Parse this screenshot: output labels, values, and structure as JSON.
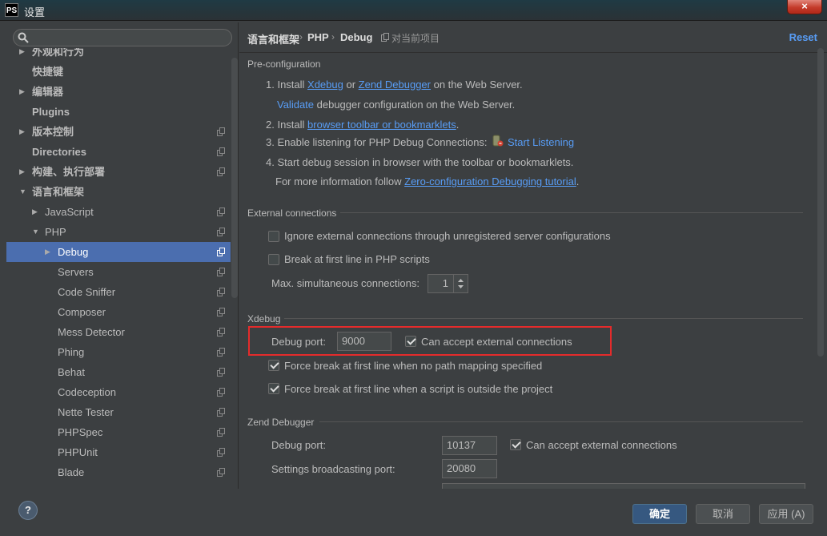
{
  "window": {
    "app_icon": "PS",
    "title": "设置",
    "close": "×"
  },
  "sidebar": {
    "search_placeholder": "",
    "items": [
      {
        "label": "外观和行为",
        "arrow": "▶",
        "bold": true
      },
      {
        "label": "快捷键",
        "arrow": "",
        "bold": true
      },
      {
        "label": "编辑器",
        "arrow": "▶",
        "bold": true
      },
      {
        "label": "Plugins",
        "arrow": "",
        "bold": true
      },
      {
        "label": "版本控制",
        "arrow": "▶",
        "bold": true
      },
      {
        "label": "Directories",
        "arrow": "",
        "bold": true
      },
      {
        "label": "构建、执行部署",
        "arrow": "▶",
        "bold": true
      },
      {
        "label": "语言和框架",
        "arrow": "▼",
        "bold": true
      },
      {
        "label": "JavaScript",
        "arrow": "▶",
        "bold": false
      },
      {
        "label": "PHP",
        "arrow": "▼",
        "bold": false
      },
      {
        "label": "Debug",
        "arrow": "▶",
        "bold": false
      },
      {
        "label": "Servers",
        "arrow": "",
        "bold": false
      },
      {
        "label": "Code Sniffer",
        "arrow": "",
        "bold": false
      },
      {
        "label": "Composer",
        "arrow": "",
        "bold": false
      },
      {
        "label": "Mess Detector",
        "arrow": "",
        "bold": false
      },
      {
        "label": "Phing",
        "arrow": "",
        "bold": false
      },
      {
        "label": "Behat",
        "arrow": "",
        "bold": false
      },
      {
        "label": "Codeception",
        "arrow": "",
        "bold": false
      },
      {
        "label": "Nette Tester",
        "arrow": "",
        "bold": false
      },
      {
        "label": "PHPSpec",
        "arrow": "",
        "bold": false
      },
      {
        "label": "PHPUnit",
        "arrow": "",
        "bold": false
      },
      {
        "label": "Blade",
        "arrow": "",
        "bold": false
      }
    ]
  },
  "header": {
    "crumb1": "语言和框架",
    "crumb2": "PHP",
    "crumb3": "Debug",
    "sep": "›",
    "project_note": "对当前项目",
    "reset": "Reset"
  },
  "preconfig": {
    "title": "Pre-configuration",
    "step1_a": "1. Install ",
    "xdebug_link": "Xdebug",
    "or": " or ",
    "zend_link": "Zend Debugger",
    "step1_b": " on the Web Server.",
    "validate_link": "Validate",
    "validate_rest": " debugger configuration on the Web Server.",
    "step2_a": "2. Install ",
    "toolbar_link": "browser toolbar or bookmarklets",
    "step2_b": ".",
    "step3": "3. Enable listening for PHP Debug Connections:",
    "start_listening": "Start Listening",
    "step4": "4. Start debug session in browser with the toolbar or bookmarklets.",
    "more_a": "For more information follow ",
    "tutorial_link": "Zero-configuration Debugging tutorial",
    "more_b": "."
  },
  "external": {
    "title": "External connections",
    "ignore": "Ignore external connections through unregistered server configurations",
    "break_first": "Break at first line in PHP scripts",
    "max_label": "Max. simultaneous connections:",
    "max_value": "1"
  },
  "xdebug": {
    "title": "Xdebug",
    "port_label": "Debug port:",
    "port_value": "9000",
    "accept": "Can accept external connections",
    "force_no_mapping": "Force break at first line when no path mapping specified",
    "force_outside": "Force break at first line when a script is outside the project"
  },
  "zend": {
    "title": "Zend Debugger",
    "port_label": "Debug port:",
    "port_value": "10137",
    "accept": "Can accept external connections",
    "broadcast_label": "Settings broadcasting port:",
    "broadcast_value": "20080"
  },
  "footer": {
    "help": "?",
    "ok": "确定",
    "cancel": "取消",
    "apply": "应用 (A)"
  },
  "colors": {
    "selection": "#4b6eaf",
    "link": "#589df6",
    "highlight": "#e52b2b",
    "background": "#3c3f41"
  }
}
